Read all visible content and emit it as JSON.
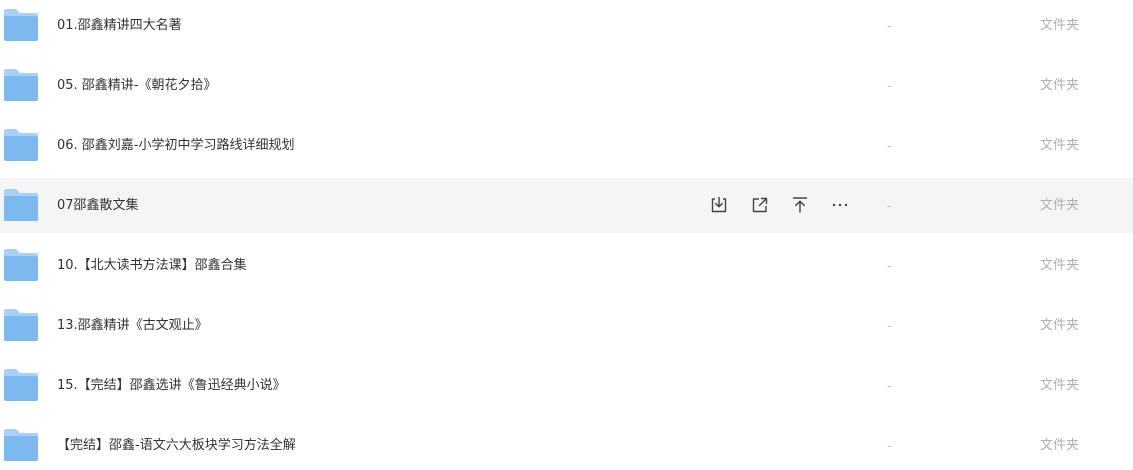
{
  "colors": {
    "hover_row_bg": "#f5f5f6",
    "folder_blue": "#7db8ee",
    "text": "#333333",
    "muted": "#b0b0b0"
  },
  "hover_actions": [
    {
      "icon": "download-icon"
    },
    {
      "icon": "share-icon"
    },
    {
      "icon": "pin-to-top-icon"
    },
    {
      "icon": "more-icon"
    }
  ],
  "files": [
    {
      "name": "01.邵鑫精讲四大名著",
      "size": "-",
      "type": "文件夹"
    },
    {
      "name": "05. 邵鑫精讲-《朝花夕拾》",
      "size": "-",
      "type": "文件夹"
    },
    {
      "name": "06. 邵鑫刘嘉-小学初中学习路线详细规划",
      "size": "-",
      "type": "文件夹"
    },
    {
      "name": "07邵鑫散文集",
      "size": "-",
      "type": "文件夹",
      "hovered": true
    },
    {
      "name": "10.【北大读书方法课】邵鑫合集",
      "size": "-",
      "type": "文件夹"
    },
    {
      "name": "13.邵鑫精讲《古文观止》",
      "size": "-",
      "type": "文件夹"
    },
    {
      "name": "15.【完结】邵鑫选讲《鲁迅经典小说》",
      "size": "-",
      "type": "文件夹"
    },
    {
      "name": "【完结】邵鑫-语文六大板块学习方法全解",
      "size": "-",
      "type": "文件夹"
    }
  ]
}
